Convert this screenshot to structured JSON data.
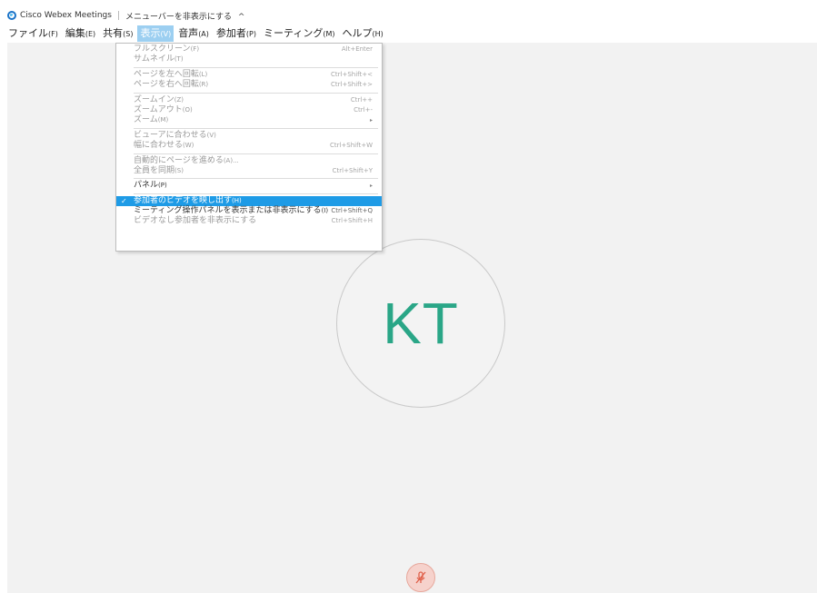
{
  "window": {
    "app_title": "Cisco Webex Meetings",
    "menubar_toggle_label": "メニューバーを非表示にする",
    "menubar_toggle_arrow": "^"
  },
  "menubar": {
    "items": [
      {
        "label": "ファイル",
        "acc": "(F)"
      },
      {
        "label": "編集",
        "acc": "(E)"
      },
      {
        "label": "共有",
        "acc": "(S)"
      },
      {
        "label": "表示",
        "acc": "(V)"
      },
      {
        "label": "音声",
        "acc": "(A)"
      },
      {
        "label": "参加者",
        "acc": "(P)"
      },
      {
        "label": "ミーティング",
        "acc": "(M)"
      },
      {
        "label": "ヘルプ",
        "acc": "(H)"
      }
    ]
  },
  "view_menu": {
    "items": [
      {
        "label": "フルスクリーン",
        "acc": "(F)",
        "shortcut": "Alt+Enter"
      },
      {
        "label": "サムネイル",
        "acc": "(T)",
        "shortcut": ""
      },
      {
        "label": "ページを左へ回転",
        "acc": "(L)",
        "shortcut": "Ctrl+Shift+<"
      },
      {
        "label": "ページを右へ回転",
        "acc": "(R)",
        "shortcut": "Ctrl+Shift+>"
      },
      {
        "label": "ズームイン",
        "acc": "(Z)",
        "shortcut": "Ctrl++"
      },
      {
        "label": "ズームアウト",
        "acc": "(O)",
        "shortcut": "Ctrl+-"
      },
      {
        "label": "ズーム",
        "acc": "(M)",
        "shortcut": ""
      },
      {
        "label": "ビューアに合わせる",
        "acc": "(V)",
        "shortcut": ""
      },
      {
        "label": "幅に合わせる",
        "acc": "(W)",
        "shortcut": "Ctrl+Shift+W"
      },
      {
        "label": "自動的にページを進める",
        "acc": "(A)...",
        "shortcut": ""
      },
      {
        "label": "全員を同期",
        "acc": "(S)",
        "shortcut": "Ctrl+Shift+Y"
      },
      {
        "label": "パネル",
        "acc": "(P)",
        "shortcut": ""
      },
      {
        "label": "参加者のビデオを映し出す",
        "acc": "(H)",
        "shortcut": ""
      },
      {
        "label": "ミーティング操作パネルを表示または非表示にする",
        "acc": "(I)",
        "shortcut": "Ctrl+Shift+Q"
      },
      {
        "label": "ビデオなし参加者を非表示にする",
        "acc": "",
        "shortcut": "Ctrl+Shift+H"
      }
    ],
    "check_mark": "✓",
    "submenu_arrow": "▸"
  },
  "participant": {
    "initials": "KT"
  },
  "colors": {
    "accent": "#1e9be6",
    "avatar_text": "#2aa687",
    "mute_bg": "#f6d2cc",
    "mute_icon": "#e0604a"
  },
  "icons": {
    "app": "webex-logo-icon",
    "mute": "microphone-muted-icon"
  }
}
